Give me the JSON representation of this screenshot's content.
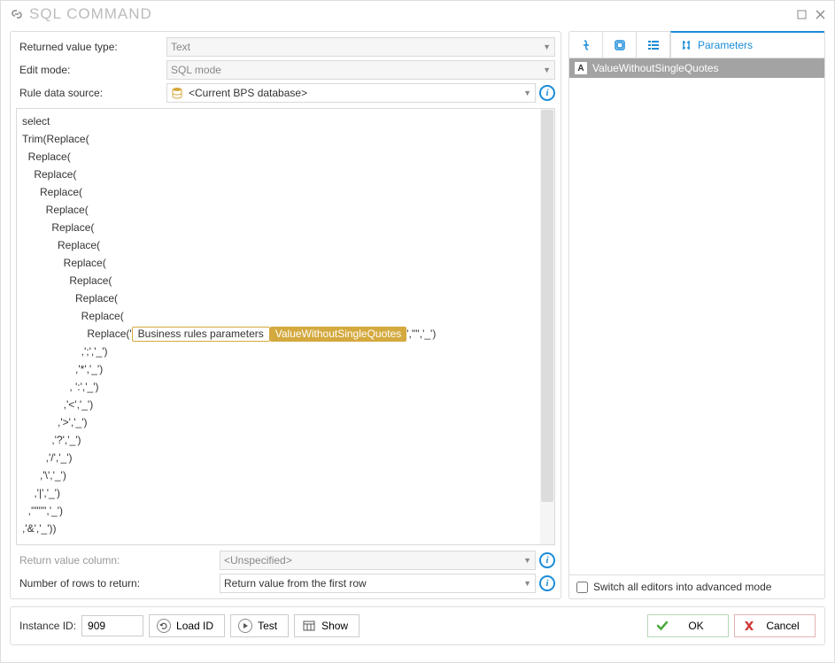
{
  "window": {
    "title": "SQL COMMAND"
  },
  "form": {
    "returned_label": "Returned value type:",
    "returned_value": "Text",
    "edit_mode_label": "Edit mode:",
    "edit_mode_value": "SQL mode",
    "data_source_label": "Rule data source:",
    "data_source_value": "<Current BPS database>",
    "return_col_label": "Return value column:",
    "return_col_value": "<Unspecified>",
    "rows_label": "Number of rows to return:",
    "rows_value": "Return value from the first row"
  },
  "code": {
    "l1": "select",
    "l2": "Trim(Replace(",
    "l3": "  Replace(",
    "l4": "    Replace(",
    "l5": "      Replace(",
    "l6": "        Replace(",
    "l7": "          Replace(",
    "l8": "            Replace(",
    "l9": "              Replace(",
    "l10": "                Replace(",
    "l11": "                  Replace(",
    "l12": "                    Replace(",
    "l13_prefix": "                      Replace('",
    "l13_tag1": "Business rules parameters",
    "l13_tag2": "ValueWithoutSingleQuotes",
    "l13_suffix": "','\"','_')",
    "l14": "                    ,';','_')",
    "l15": "                  ,'*','_')",
    "l16": "                , ':','_')",
    "l17": "              ,'<','_')",
    "l18": "            ,'>','_')",
    "l19": "          ,'?','_')",
    "l20": "        ,'/','_')",
    "l21": "      ,'\\','_')",
    "l22": "    ,'|','_')",
    "l23": "  ,'\"\"\"','_')",
    "l24": ",'&','_'))"
  },
  "tabs": {
    "param_label": "Parameters"
  },
  "params": {
    "item1_badge": "A",
    "item1": "ValueWithoutSingleQuotes"
  },
  "switch_label": "Switch all editors into advanced mode",
  "footer": {
    "instance_label": "Instance ID:",
    "instance_value": "909",
    "load": "Load ID",
    "test": "Test",
    "show": "Show",
    "ok": "OK",
    "cancel": "Cancel"
  }
}
